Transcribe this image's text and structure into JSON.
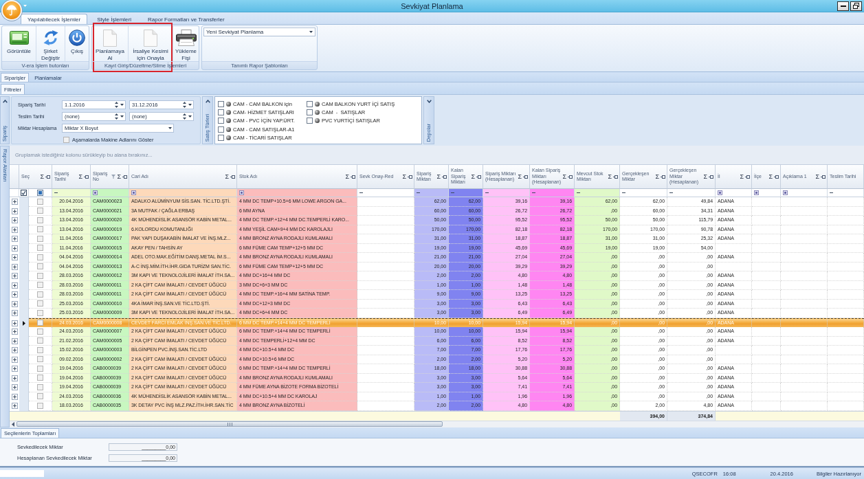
{
  "window": {
    "title": "Sevkiyat Planlama"
  },
  "ribbon": {
    "tabs": [
      {
        "label": "Yapılabilecek İşlemler",
        "selected": true
      },
      {
        "label": "Style İşlemleri",
        "selected": false
      },
      {
        "label": "Rapor Formatları ve Transferler",
        "selected": false
      }
    ],
    "groups": [
      {
        "label": "V-era İşlem butonları",
        "highlighted": false,
        "buttons": [
          {
            "label": "Görüntüle"
          },
          {
            "label": "Şirket\nDeğiştir"
          },
          {
            "label": "Çıkış"
          }
        ]
      },
      {
        "label": "Kayıt Giriş/Düzeltme/Silme İşlemleri",
        "highlighted": true,
        "buttons": [
          {
            "label": "Planlamaya\nAl"
          },
          {
            "label": "İrsaliye Kesimi\niçin Onayla"
          },
          {
            "label": "Yükleme\nFişi"
          }
        ]
      },
      {
        "label": "Tanımlı Rapor Şablonları",
        "highlighted": false,
        "dropdown": {
          "value": "Yeni Sevkiyat Planlama"
        }
      }
    ]
  },
  "page_tabs": [
    {
      "label": "Siparişler",
      "selected": true
    },
    {
      "label": "Planlamalar",
      "selected": false
    }
  ],
  "filter_tabs": [
    {
      "label": "Filtreler",
      "selected": true
    }
  ],
  "filters": {
    "side_label": "Sipariş",
    "expanded": true,
    "dates": [
      {
        "label": "Sipariş Tarihi",
        "from": "1.1.2016",
        "to": "31.12.2016"
      },
      {
        "label": "Teslim Tarihi",
        "from": "(none)",
        "to": "(none)"
      }
    ],
    "quantity": {
      "label": "Miktar Hesaplama",
      "value": "Miktar X Boyut"
    },
    "option": {
      "label": "Aşamalarda Makine Adlarını Göster",
      "checked": false
    },
    "sales_types": {
      "side_label": "Satış Türleri",
      "expanded": true,
      "items": [
        {
          "label": "CAM - CAM BALKON için",
          "checked": false
        },
        {
          "label": "CAM- HİZMET SATIŞLARI",
          "checked": false
        },
        {
          "label": "CAM - PVC İÇİN YAP.ÜRT.",
          "checked": false
        },
        {
          "label": "CAM - CAM SATIŞLAR-A1",
          "checked": false
        },
        {
          "label": "CAM - TİCARİ SATIŞLAR",
          "checked": false
        },
        {
          "label": "CAM BALKON YURT İÇİ SATIŞ",
          "checked": false
        },
        {
          "label": "CAM  -  SATIŞLAR",
          "checked": false
        },
        {
          "label": "PVC YURTİÇİ SATIŞLAR",
          "checked": false
        }
      ]
    },
    "warehouses": {
      "side_label": "Depolar",
      "expanded": false
    }
  },
  "grid": {
    "side_label": "Rapor Alanları",
    "group_hint": "Gruplamak istediğiniz kolonu sürükleyip bu alana bırakınız...",
    "select_all_partial": true,
    "columns": [
      {
        "label": "Seç",
        "kind": "check",
        "sum": "Σ",
        "filtered": false
      },
      {
        "label": "Sipariş Tarihi",
        "kind": "date",
        "sum": "Σ",
        "filtered": false,
        "color": "#eefbd2"
      },
      {
        "label": "Sipariş No",
        "kind": "text",
        "sum": "Σ",
        "filtered": true,
        "color": "#c8f7c0"
      },
      {
        "label": "Cari Adı",
        "kind": "text",
        "sum": "Σ",
        "filtered": false,
        "color": "#fdd9ba"
      },
      {
        "label": "Stok Adı",
        "kind": "text",
        "sum": "Σ",
        "filtered": false,
        "color": "#fbbcbc"
      },
      {
        "label": "Sevk Onay-Red",
        "kind": "number",
        "sum": "Σ",
        "filtered": false
      },
      {
        "label": "Sipariş Miktarı",
        "kind": "number",
        "sum": "Σ",
        "filtered": false,
        "color": "#b9bbf7"
      },
      {
        "label": "Kalan Sipariş Miktarı",
        "kind": "number",
        "sum": "Σ",
        "filtered": false,
        "color": "#8083f0"
      },
      {
        "label": "Sipariş Miktarı (Hesaplanan)",
        "kind": "number",
        "sum": "Σ",
        "filtered": false,
        "color": "#ffc2f7"
      },
      {
        "label": "Kalan Sipariş Miktarı (Hesaplanan)",
        "kind": "number",
        "sum": "Σ",
        "filtered": false,
        "color": "#ff86f2"
      },
      {
        "label": "Mevcut Stok Miktarı",
        "kind": "number",
        "sum": "Σ",
        "filtered": false,
        "color": "#e0f9c8"
      },
      {
        "label": "Gerçekleşen Miktar",
        "kind": "number",
        "sum": "Σ",
        "filtered": false,
        "total": "394,00"
      },
      {
        "label": "Gerçekleşen Miktar (Hesaplanan)",
        "kind": "number",
        "sum": "Σ",
        "filtered": false,
        "total": "374,84"
      },
      {
        "label": "İl",
        "kind": "text",
        "sum": "Σ",
        "filtered": false
      },
      {
        "label": "İlçe",
        "kind": "text",
        "sum": "Σ",
        "filtered": false
      },
      {
        "label": "Açıklama 1",
        "kind": "text",
        "sum": "Σ",
        "filtered": false
      },
      {
        "label": "Teslim Tarihi",
        "kind": "date",
        "filtered": false
      }
    ],
    "rows": [
      {
        "expanded": false,
        "checked": false,
        "selected": false,
        "cells": [
          "",
          "20.04.2016",
          "CAM0000023",
          "ADALKO ALÜMİNYUM SİS.SAN. TİC.LTD.ŞTİ.",
          "4 MM DC TEMP+10.5+6 MM LOWE ARGON GA...",
          "",
          "62,00",
          "62,00",
          "39,16",
          "39,16",
          "62,00",
          "62,00",
          "49,84",
          "ADANA",
          "",
          "",
          ""
        ]
      },
      {
        "expanded": false,
        "checked": false,
        "selected": false,
        "cells": [
          "",
          "13.04.2016",
          "CAM0000021",
          "3A MUTFAK / ÇAĞLA ERBAŞ",
          "6 MM AYNA",
          "",
          "60,00",
          "60,00",
          "26,72",
          "26,72",
          ",00",
          "60,00",
          "34,31",
          "ADANA",
          "",
          "",
          ""
        ]
      },
      {
        "expanded": false,
        "checked": false,
        "selected": false,
        "cells": [
          "",
          "13.04.2016",
          "CAM0000020",
          "4K MÜHENDİSLİK ASANSÖR KABİN METAL...",
          "4 MM DC TEMP.+12+4 MM DC.TEMPERLİ KARO...",
          "",
          "50,00",
          "50,00",
          "95,52",
          "95,52",
          "50,00",
          "50,00",
          "115,79",
          "ADANA",
          "",
          "",
          ""
        ]
      },
      {
        "expanded": false,
        "checked": false,
        "selected": false,
        "cells": [
          "",
          "13.04.2016",
          "CAM0000019",
          "6.KOLORDU KOMUTANLIĞI",
          "4 MM YEŞİL CAM+9+4 MM DC KAROLAJLI",
          "",
          "170,00",
          "170,00",
          "82,18",
          "82,18",
          "170,00",
          "170,00",
          "90,78",
          "ADANA",
          "",
          "",
          ""
        ]
      },
      {
        "expanded": false,
        "checked": false,
        "selected": false,
        "cells": [
          "",
          "11.04.2016",
          "CAM0000017",
          "PAK YAPI DUŞAKABİN İMALAT VE İNŞ.MLZ...",
          "4 MM BRONZ AYNA RODAJLI KUMLAMALI",
          "",
          "31,00",
          "31,00",
          "18,87",
          "18,87",
          "31,00",
          "31,00",
          "25,32",
          "ADANA",
          "",
          "",
          ""
        ]
      },
      {
        "expanded": false,
        "checked": false,
        "selected": false,
        "cells": [
          "",
          "11.04.2016",
          "CAM0000015",
          "AKAY PEN / TAHSİN AY",
          "6 MM FÜME CAM TEMP+12+5 MM DC",
          "",
          "19,00",
          "19,00",
          "45,69",
          "45,69",
          "19,00",
          "19,00",
          "54,00",
          "",
          "",
          "",
          ""
        ]
      },
      {
        "expanded": false,
        "checked": false,
        "selected": false,
        "cells": [
          "",
          "04.04.2016",
          "CAM0000014",
          "ADEL OTO.MAK.EĞİTİM DANŞ.METAL İM.S...",
          "4 MM BRONZ AYNA RODAJLI KUMLAMALI",
          "",
          "21,00",
          "21,00",
          "27,04",
          "27,04",
          ",00",
          ",00",
          ",00",
          "ADANA",
          "",
          "",
          ""
        ]
      },
      {
        "expanded": false,
        "checked": false,
        "selected": false,
        "cells": [
          "",
          "04.04.2016",
          "CAM0000013",
          "A-C İNŞ.MİM.İTH.İHR.GIDA TURİZM SAN.TİC.",
          "6 MM FÜME CAM TEMP+12+5 MM DC",
          "",
          "20,00",
          "20,00",
          "39,29",
          "39,29",
          ",00",
          ",00",
          ",00",
          "",
          "",
          "",
          ""
        ]
      },
      {
        "expanded": false,
        "checked": false,
        "selected": false,
        "cells": [
          "",
          "28.03.2016",
          "CAM0000012",
          "3M KAPI VE TEKNOLOJİLERİ İMALAT İTH.SA...",
          "4 MM DC+16+4 MM DC",
          "",
          "2,00",
          "2,00",
          "4,80",
          "4,80",
          ",00",
          ",00",
          ",00",
          "ADANA",
          "",
          "",
          ""
        ]
      },
      {
        "expanded": false,
        "checked": false,
        "selected": false,
        "cells": [
          "",
          "28.03.2016",
          "CAM0000011",
          "2 KA ÇİFT CAM İMALATI / CEVDET ÜĞÜCÜ",
          "3 MM DC+6+3 MM DC",
          "",
          "1,00",
          "1,00",
          "1,48",
          "1,48",
          ",00",
          ",00",
          ",00",
          "ADANA",
          "",
          "",
          ""
        ]
      },
      {
        "expanded": false,
        "checked": false,
        "selected": false,
        "cells": [
          "",
          "28.03.2016",
          "CAM0000011",
          "2 KA ÇİFT CAM İMALATI / CEVDET ÜĞÜCÜ",
          "4 MM DC TEMP.+16+4 MM SATİNA TEMP.",
          "",
          "9,00",
          "9,00",
          "13,25",
          "13,25",
          ",00",
          ",00",
          ",00",
          "ADANA",
          "",
          "",
          ""
        ]
      },
      {
        "expanded": false,
        "checked": false,
        "selected": false,
        "cells": [
          "",
          "25.03.2016",
          "CAM0000010",
          "4KA İMAR İNŞ.SAN.VE TİC.LTD.ŞTİ.",
          "4 MM DC+12+3 MM DC",
          "",
          "3,00",
          "3,00",
          "6,43",
          "6,43",
          ",00",
          ",00",
          ",00",
          "ADANA",
          "",
          "",
          ""
        ]
      },
      {
        "expanded": false,
        "checked": false,
        "selected": false,
        "cells": [
          "",
          "25.03.2016",
          "CAM0000009",
          "3M KAPI VE TEKNOLOJİLERİ İMALAT İTH.SA...",
          "4 MM DC+6+4 MM DC",
          "",
          "3,00",
          "3,00",
          "6,49",
          "6,49",
          ",00",
          ",00",
          ",00",
          "ADANA",
          "",
          "",
          ""
        ]
      },
      {
        "expanded": false,
        "checked": false,
        "selected": true,
        "cells": [
          "",
          "24.03.2016",
          "CAM0000008",
          "CEVDET FARCI EMLAK İNŞ.SAN.VE TİC.LTD.",
          "6 MM DC TEMP.+14+4 MM DC TEMPERLİ",
          "",
          "10,00",
          "10,00",
          "15,94",
          "15,94",
          ",00",
          ",00",
          ",00",
          "ADANA",
          "",
          "",
          ""
        ]
      },
      {
        "expanded": false,
        "checked": false,
        "selected": false,
        "cells": [
          "",
          "24.03.2016",
          "CAM0000007",
          "2 KA ÇİFT CAM İMALATI / CEVDET ÜĞÜCÜ",
          "6 MM DC TEMP.+14+4 MM DC TEMPERLİ",
          "",
          "10,00",
          "10,00",
          "15,94",
          "15,94",
          ",00",
          ",00",
          ",00",
          "ADANA",
          "",
          "",
          ""
        ]
      },
      {
        "expanded": false,
        "checked": false,
        "selected": false,
        "cells": [
          "",
          "21.02.2016",
          "CAM0000005",
          "2 KA ÇİFT CAM İMALATI / CEVDET ÜĞÜCÜ",
          "4 MM DC TEMPERLİ+12+4 MM DC",
          "",
          "6,00",
          "6,00",
          "8,52",
          "8,52",
          ",00",
          ",00",
          ",00",
          "ADANA",
          "",
          "",
          ""
        ]
      },
      {
        "expanded": false,
        "checked": false,
        "selected": false,
        "cells": [
          "",
          "15.02.2016",
          "CAM0000003",
          "BİLGİNPEN PVC.İNŞ.SAN.TİC.LTD",
          "4 MM DC+10.5+4 MM DC",
          "",
          "7,00",
          "7,00",
          "17,76",
          "17,76",
          ",00",
          ",00",
          ",00",
          "",
          "",
          "",
          ""
        ]
      },
      {
        "expanded": false,
        "checked": false,
        "selected": false,
        "cells": [
          "",
          "09.02.2016",
          "CAM0000002",
          "2 KA ÇİFT CAM İMALATI / CEVDET ÜĞÜCÜ",
          "4 MM DC+10.5+6 MM DC",
          "",
          "2,00",
          "2,00",
          "5,20",
          "5,20",
          ",00",
          ",00",
          ",00",
          "",
          "",
          "",
          ""
        ]
      },
      {
        "expanded": false,
        "checked": false,
        "selected": false,
        "cells": [
          "",
          "19.04.2016",
          "CAB0000039",
          "2 KA ÇİFT CAM İMALATI / CEVDET ÜĞÜCÜ",
          "6 MM DC TEMP.+14+4 MM DC TEMPERLİ",
          "",
          "18,00",
          "18,00",
          "30,88",
          "30,88",
          ",00",
          ",00",
          ",00",
          "ADANA",
          "",
          "",
          ""
        ]
      },
      {
        "expanded": false,
        "checked": false,
        "selected": false,
        "cells": [
          "",
          "19.04.2016",
          "CAB0000039",
          "2 KA ÇİFT CAM İMALATI / CEVDET ÜĞÜCÜ",
          "4 MM BRONZ AYNA RODAJLI KUMLAMALI",
          "",
          "3,00",
          "3,00",
          "5,64",
          "5,64",
          ",00",
          ",00",
          ",00",
          "ADANA",
          "",
          "",
          ""
        ]
      },
      {
        "expanded": false,
        "checked": false,
        "selected": false,
        "cells": [
          "",
          "19.04.2016",
          "CAB0000039",
          "2 KA ÇİFT CAM İMALATI / CEVDET ÜĞÜCÜ",
          "4 MM FÜME AYNA BİZOTE FORMA BİZOTELİ",
          "",
          "3,00",
          "3,00",
          "7,41",
          "7,41",
          ",00",
          ",00",
          ",00",
          "ADANA",
          "",
          "",
          ""
        ]
      },
      {
        "expanded": false,
        "checked": false,
        "selected": false,
        "cells": [
          "",
          "24.03.2016",
          "CAB0000036",
          "4K MÜHENDİSLİK ASANSÖR KABİN METAL...",
          "4 MM DC+10.5+4 MM DC KAROLAJ",
          "",
          "1,00",
          "1,00",
          "1,96",
          "1,96",
          ",00",
          ",00",
          ",00",
          "ADANA",
          "",
          "",
          ""
        ]
      },
      {
        "expanded": false,
        "checked": false,
        "selected": false,
        "cells": [
          "",
          "18.03.2016",
          "CAB0000035",
          "3K DETAY PVC İNŞ MLZ.PAZ.İTH.İHR.SAN.TİC",
          "4 MM BRONZ AYNA BİZOTELİ",
          "",
          "2,00",
          "2,00",
          "4,80",
          "4,80",
          ",00",
          "2,00",
          "4,80",
          "ADANA",
          "",
          "",
          ""
        ]
      }
    ]
  },
  "summary_tabs": [
    {
      "label": "Seçilenlerin Toplamları",
      "selected": true
    }
  ],
  "summary": [
    {
      "label": "Sevkedilecek Miktar",
      "value": "_________0,00"
    },
    {
      "label": "Hesaplanan Sevkedilecek Miktar",
      "value": "_________0,00"
    }
  ],
  "status_bar": {
    "user": "QSECOFR",
    "time": "16:08",
    "date": "20.4.2016",
    "message": "Bilgiler Hazırlanıyor"
  }
}
